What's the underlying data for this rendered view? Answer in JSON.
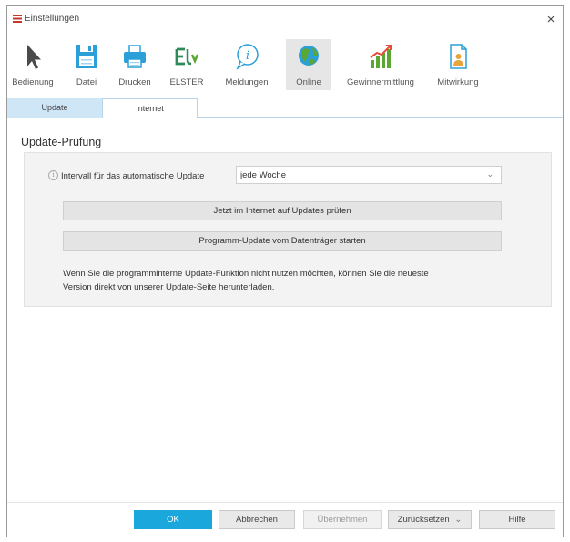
{
  "window": {
    "title": "Einstellungen",
    "close_glyph": "×"
  },
  "toolbar": {
    "items": [
      {
        "label": "Bedienung",
        "icon": "cursor-arrow-icon"
      },
      {
        "label": "Datei",
        "icon": "floppy-disk-icon"
      },
      {
        "label": "Drucken",
        "icon": "printer-icon"
      },
      {
        "label": "ELSTER",
        "icon": "elster-logo-icon"
      },
      {
        "label": "Meldungen",
        "icon": "info-bubble-icon"
      },
      {
        "label": "Online",
        "icon": "globe-icon",
        "active": true
      },
      {
        "label": "Gewinnermittlung",
        "icon": "bar-chart-growth-icon"
      },
      {
        "label": "Mitwirkung",
        "icon": "document-person-icon"
      }
    ]
  },
  "tabs": [
    {
      "label": "Update",
      "active": true
    },
    {
      "label": "Internet",
      "active": false
    }
  ],
  "section": {
    "title": "Update-Prüfung"
  },
  "update": {
    "info_glyph": "i",
    "interval_label": "Intervall für das automatische Update",
    "interval_value": "jede Woche",
    "chevron_glyph": "⌄",
    "check_button": "Jetzt im Internet auf Updates prüfen",
    "media_button": "Programm-Update vom Datenträger starten",
    "hint_line1": "Wenn Sie die programminterne Update-Funktion nicht nutzen möchten, können Sie die neueste",
    "hint_pre_link": "Version direkt von unserer ",
    "hint_link": "Update-Seite",
    "hint_post_link": " herunterladen."
  },
  "footer": {
    "ok": "OK",
    "cancel": "Abbrechen",
    "apply": "Übernehmen",
    "reset": "Zurücksetzen",
    "reset_chevron": "⌄",
    "help": "Hilfe"
  },
  "colors": {
    "accent": "#1aa8dc",
    "tab_active_bg": "#cfe6f7",
    "active_tool_bg": "#e6e6e6",
    "icon_blue": "#2a9fd8",
    "icon_green": "#5aa832"
  }
}
